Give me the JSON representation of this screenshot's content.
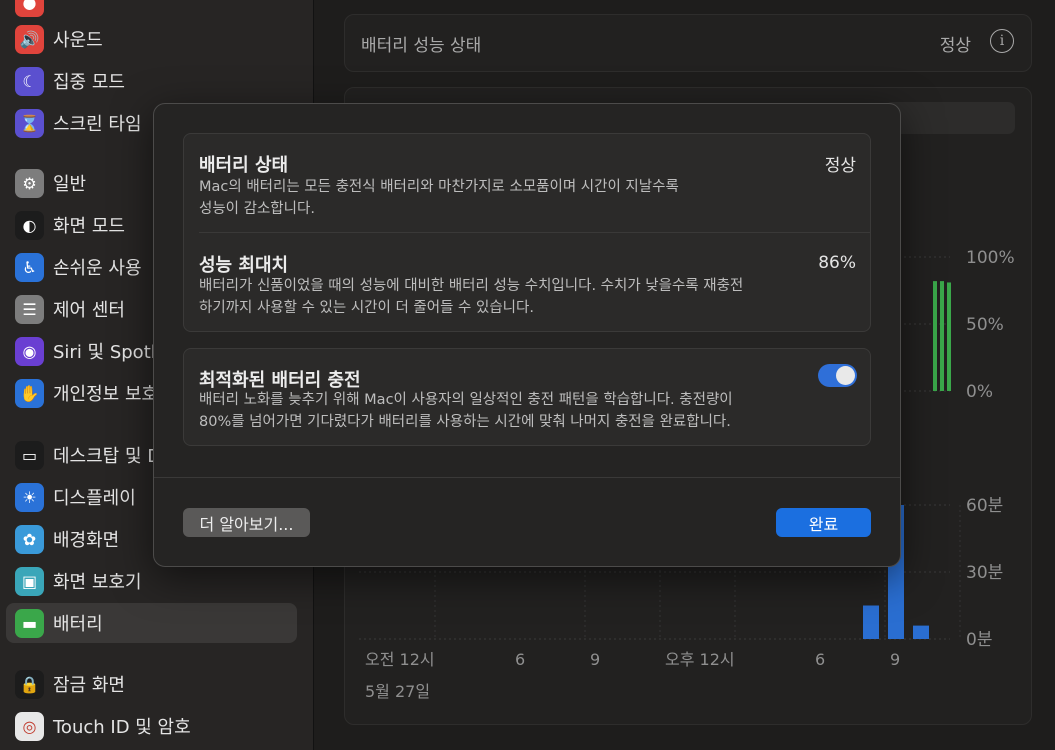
{
  "sidebar": {
    "items": [
      {
        "label": "사운드",
        "icon": "speaker-icon",
        "color": "#e0443c",
        "glyph": "🔊"
      },
      {
        "label": "집중 모드",
        "icon": "moon-icon",
        "color": "#5b50cf",
        "glyph": "☾"
      },
      {
        "label": "스크린 타임",
        "icon": "hourglass-icon",
        "color": "#5b50cf",
        "glyph": "⌛"
      },
      {
        "label": "일반",
        "icon": "gear-icon",
        "color": "#7d7d7d",
        "glyph": "⚙"
      },
      {
        "label": "화면 모드",
        "icon": "appearance-icon",
        "color": "#1c1c1c",
        "glyph": "◐"
      },
      {
        "label": "손쉬운 사용",
        "icon": "accessibility-icon",
        "color": "#2a72d8",
        "glyph": "♿"
      },
      {
        "label": "제어 센터",
        "icon": "toggles-icon",
        "color": "#7d7d7d",
        "glyph": "☰"
      },
      {
        "label": "Siri 및 Spotlight",
        "icon": "siri-icon",
        "color": "#6a3fd2",
        "glyph": "◉"
      },
      {
        "label": "개인정보 보호 및 보안",
        "icon": "hand-icon",
        "color": "#2a72d8",
        "glyph": "✋"
      },
      {
        "label": "데스크탑 및 Dock",
        "icon": "dock-icon",
        "color": "#1c1c1c",
        "glyph": "▭"
      },
      {
        "label": "디스플레이",
        "icon": "sun-icon",
        "color": "#2a72d8",
        "glyph": "☀"
      },
      {
        "label": "배경화면",
        "icon": "flower-icon",
        "color": "#3a9ad9",
        "glyph": "✿"
      },
      {
        "label": "화면 보호기",
        "icon": "screensaver-icon",
        "color": "#3aa6b9",
        "glyph": "▣"
      },
      {
        "label": "배터리",
        "icon": "battery-icon",
        "color": "#3aa74a",
        "glyph": "▬"
      },
      {
        "label": "잠금 화면",
        "icon": "lock-icon",
        "color": "#1c1c1c",
        "glyph": "🔒"
      },
      {
        "label": "Touch ID 및 암호",
        "icon": "fingerprint-icon",
        "color": "#e8e8e8",
        "glyph": "◎"
      }
    ]
  },
  "main": {
    "header_title": "배터리 성능 상태",
    "header_status": "정상",
    "chart_data": [
      {
        "type": "bar",
        "ylabels": [
          "100%",
          "50%",
          "0%"
        ],
        "series": [
          {
            "values": [
              0.82,
              0.82,
              0.81
            ]
          }
        ],
        "color": "#3aa74a"
      },
      {
        "type": "bar",
        "ylabels": [
          "60분",
          "30분",
          "0분"
        ],
        "categories": [
          "오전 12시",
          "6",
          "9",
          "오후 12시",
          "6",
          "9"
        ],
        "date": "5월 27일",
        "ylim": [
          0,
          60
        ],
        "series": [
          {
            "values": [
              15,
              60,
              6
            ]
          }
        ],
        "color": "#2a6ed1"
      }
    ]
  },
  "modal": {
    "battery_state": {
      "title": "배터리 상태",
      "value": "정상",
      "desc1": "Mac의 배터리는 모든 충전식 배터리와 마찬가지로 소모품이며 시간이 지날수록",
      "desc2": "성능이 감소합니다."
    },
    "max_capacity": {
      "title": "성능 최대치",
      "value": "86%",
      "desc1": "배터리가 신품이었을 때의 성능에 대비한 배터리 성능 수치입니다. 수치가 낮을수록 재충전",
      "desc2": "하기까지 사용할 수 있는 시간이 더 줄어들 수 있습니다."
    },
    "optimized": {
      "title": "최적화된 배터리 충전",
      "enabled": true,
      "desc1": "배터리 노화를 늦추기 위해 Mac이 사용자의 일상적인 충전 패턴을 학습합니다. 충전량이",
      "desc2": "80%를 넘어가면 기다렸다가 배터리를 사용하는 시간에 맞춰 나머지 충전을 완료합니다."
    },
    "learn_more": "더 알아보기...",
    "done": "완료"
  }
}
